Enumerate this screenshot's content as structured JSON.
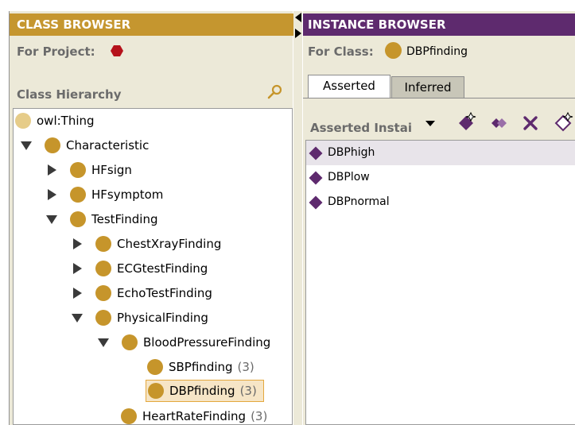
{
  "class_browser": {
    "title": "CLASS BROWSER",
    "project_label": "For Project:",
    "hierarchy_label": "Class Hierarchy",
    "tree": [
      {
        "label": "owl:Thing",
        "count": ""
      },
      {
        "label": "Characteristic",
        "count": ""
      },
      {
        "label": "HFsign",
        "count": ""
      },
      {
        "label": "HFsymptom",
        "count": ""
      },
      {
        "label": "TestFinding",
        "count": ""
      },
      {
        "label": "ChestXrayFinding",
        "count": ""
      },
      {
        "label": "ECGtestFinding",
        "count": ""
      },
      {
        "label": "EchoTestFinding",
        "count": ""
      },
      {
        "label": "PhysicalFinding",
        "count": ""
      },
      {
        "label": "BloodPressureFinding",
        "count": ""
      },
      {
        "label": "SBPfinding",
        "count": "(3)"
      },
      {
        "label": "DBPfinding",
        "count": "(3)"
      },
      {
        "label": "HeartRateFinding",
        "count": "(3)"
      }
    ]
  },
  "instance_browser": {
    "title": "INSTANCE BROWSER",
    "class_label": "For Class:",
    "class_name": "DBPfinding",
    "tabs": [
      "Asserted",
      "Inferred"
    ],
    "list_title": "Asserted Instai",
    "instances": [
      "DBPhigh",
      "DBPlow",
      "DBPnormal"
    ]
  },
  "colors": {
    "class_header": "#c5962f",
    "instance_header": "#5e2a6e",
    "class_dot": "#c6952b",
    "instance_diamond": "#5e2a6e",
    "project_hex": "#b5121b"
  },
  "icons": [
    "hexagon-project-icon",
    "find-class-icon",
    "dropdown-arrow-icon",
    "create-instance-icon",
    "copy-instance-icon",
    "delete-instance-icon",
    "more-actions-icon"
  ]
}
